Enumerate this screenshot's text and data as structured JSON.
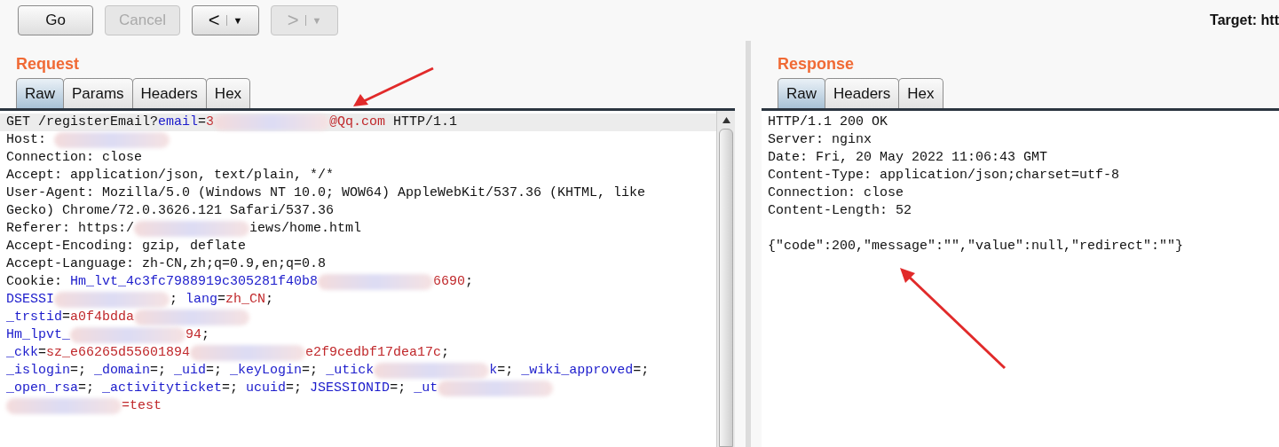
{
  "toolbar": {
    "buttons": [
      {
        "label": "Go",
        "disabled": false
      },
      {
        "label": "Cancel",
        "disabled": true
      }
    ],
    "history": [
      {
        "arrow": "<",
        "dropdown": "▼",
        "disabled": false
      },
      {
        "arrow": ">",
        "dropdown": "▼",
        "disabled": true
      }
    ],
    "target": "Target: htt"
  },
  "request": {
    "title": "Request",
    "tabs": [
      {
        "label": "Raw",
        "selected": true
      },
      {
        "label": "Params",
        "selected": false
      },
      {
        "label": "Headers",
        "selected": false
      },
      {
        "label": "Hex",
        "selected": false
      }
    ],
    "lines": [
      {
        "selected": true,
        "segments": [
          {
            "kind": "plain",
            "text": "GET /registerEmail?"
          },
          {
            "kind": "param",
            "text": "email"
          },
          {
            "kind": "plain",
            "text": "="
          },
          {
            "kind": "value",
            "text": "3"
          },
          {
            "kind": "redacted"
          },
          {
            "kind": "value",
            "text": "@Qq.com"
          },
          {
            "kind": "plain",
            "text": " HTTP/1.1"
          }
        ]
      },
      {
        "selected": false,
        "segments": [
          {
            "kind": "plain",
            "text": "Host: "
          },
          {
            "kind": "redacted"
          }
        ]
      },
      {
        "selected": false,
        "segments": [
          {
            "kind": "plain",
            "text": "Connection: close"
          }
        ]
      },
      {
        "selected": false,
        "segments": [
          {
            "kind": "plain",
            "text": "Accept: application/json, text/plain, */*"
          }
        ]
      },
      {
        "selected": false,
        "segments": [
          {
            "kind": "plain",
            "text": "User-Agent: Mozilla/5.0 (Windows NT 10.0; WOW64) AppleWebKit/537.36 (KHTML, like"
          }
        ]
      },
      {
        "selected": false,
        "segments": [
          {
            "kind": "plain",
            "text": "Gecko) Chrome/72.0.3626.121 Safari/537.36"
          }
        ]
      },
      {
        "selected": false,
        "segments": [
          {
            "kind": "plain",
            "text": "Referer: https:/"
          },
          {
            "kind": "redacted"
          },
          {
            "kind": "plain",
            "text": "iews/home.html"
          }
        ]
      },
      {
        "selected": false,
        "segments": [
          {
            "kind": "plain",
            "text": "Accept-Encoding: gzip, deflate"
          }
        ]
      },
      {
        "selected": false,
        "segments": [
          {
            "kind": "plain",
            "text": "Accept-Language: zh-CN,zh;q=0.9,en;q=0.8"
          }
        ]
      },
      {
        "selected": false,
        "segments": [
          {
            "kind": "plain",
            "text": "Cookie: "
          },
          {
            "kind": "param",
            "text": "Hm_lvt_4c3fc7988919c305281f40b8"
          },
          {
            "kind": "redacted"
          },
          {
            "kind": "value",
            "text": "6690"
          },
          {
            "kind": "plain",
            "text": ";"
          }
        ]
      },
      {
        "selected": false,
        "segments": [
          {
            "kind": "param",
            "text": "DSESSI"
          },
          {
            "kind": "redacted"
          },
          {
            "kind": "plain",
            "text": "; "
          },
          {
            "kind": "param",
            "text": "lang"
          },
          {
            "kind": "plain",
            "text": "="
          },
          {
            "kind": "value",
            "text": "zh_CN"
          },
          {
            "kind": "plain",
            "text": ";"
          }
        ]
      },
      {
        "selected": false,
        "segments": [
          {
            "kind": "param",
            "text": "_trstid"
          },
          {
            "kind": "plain",
            "text": "="
          },
          {
            "kind": "value",
            "text": "a0f4bdda"
          },
          {
            "kind": "redacted"
          }
        ]
      },
      {
        "selected": false,
        "segments": [
          {
            "kind": "param",
            "text": "Hm_lpvt_"
          },
          {
            "kind": "redacted"
          },
          {
            "kind": "value",
            "text": "94"
          },
          {
            "kind": "plain",
            "text": ";"
          }
        ]
      },
      {
        "selected": false,
        "segments": [
          {
            "kind": "param",
            "text": "_ckk"
          },
          {
            "kind": "plain",
            "text": "="
          },
          {
            "kind": "value",
            "text": "sz_e66265d55601894"
          },
          {
            "kind": "redacted"
          },
          {
            "kind": "value",
            "text": "e2f9cedbf17dea17c"
          },
          {
            "kind": "plain",
            "text": ";"
          }
        ]
      },
      {
        "selected": false,
        "segments": [
          {
            "kind": "param",
            "text": "_islogin"
          },
          {
            "kind": "plain",
            "text": "=; "
          },
          {
            "kind": "param",
            "text": "_domain"
          },
          {
            "kind": "plain",
            "text": "=; "
          },
          {
            "kind": "param",
            "text": "_uid"
          },
          {
            "kind": "plain",
            "text": "=; "
          },
          {
            "kind": "param",
            "text": "_keyLogin"
          },
          {
            "kind": "plain",
            "text": "=; "
          },
          {
            "kind": "param",
            "text": "_utick"
          },
          {
            "kind": "redacted"
          },
          {
            "kind": "param",
            "text": "k"
          },
          {
            "kind": "plain",
            "text": "=; "
          },
          {
            "kind": "param",
            "text": "_wiki_approved"
          },
          {
            "kind": "plain",
            "text": "=;"
          }
        ]
      },
      {
        "selected": false,
        "segments": [
          {
            "kind": "param",
            "text": "_open_rsa"
          },
          {
            "kind": "plain",
            "text": "=; "
          },
          {
            "kind": "param",
            "text": "_activityticket"
          },
          {
            "kind": "plain",
            "text": "=; "
          },
          {
            "kind": "param",
            "text": "ucuid"
          },
          {
            "kind": "plain",
            "text": "=; "
          },
          {
            "kind": "param",
            "text": "JSESSIONID"
          },
          {
            "kind": "plain",
            "text": "=; "
          },
          {
            "kind": "param",
            "text": "_ut"
          },
          {
            "kind": "redacted"
          }
        ]
      },
      {
        "selected": false,
        "segments": [
          {
            "kind": "redacted"
          },
          {
            "kind": "value",
            "text": "=test"
          }
        ]
      }
    ]
  },
  "response": {
    "title": "Response",
    "tabs": [
      {
        "label": "Raw",
        "selected": true
      },
      {
        "label": "Headers",
        "selected": false
      },
      {
        "label": "Hex",
        "selected": false
      }
    ],
    "headers": [
      "HTTP/1.1 200 OK",
      "Server: nginx",
      "Date: Fri, 20 May 2022 11:06:43 GMT",
      "Content-Type: application/json;charset=utf-8",
      "Connection: close",
      "Content-Length: 52"
    ],
    "body": "{\"code\":200,\"message\":\"\",\"value\":null,\"redirect\":\"\"}"
  }
}
